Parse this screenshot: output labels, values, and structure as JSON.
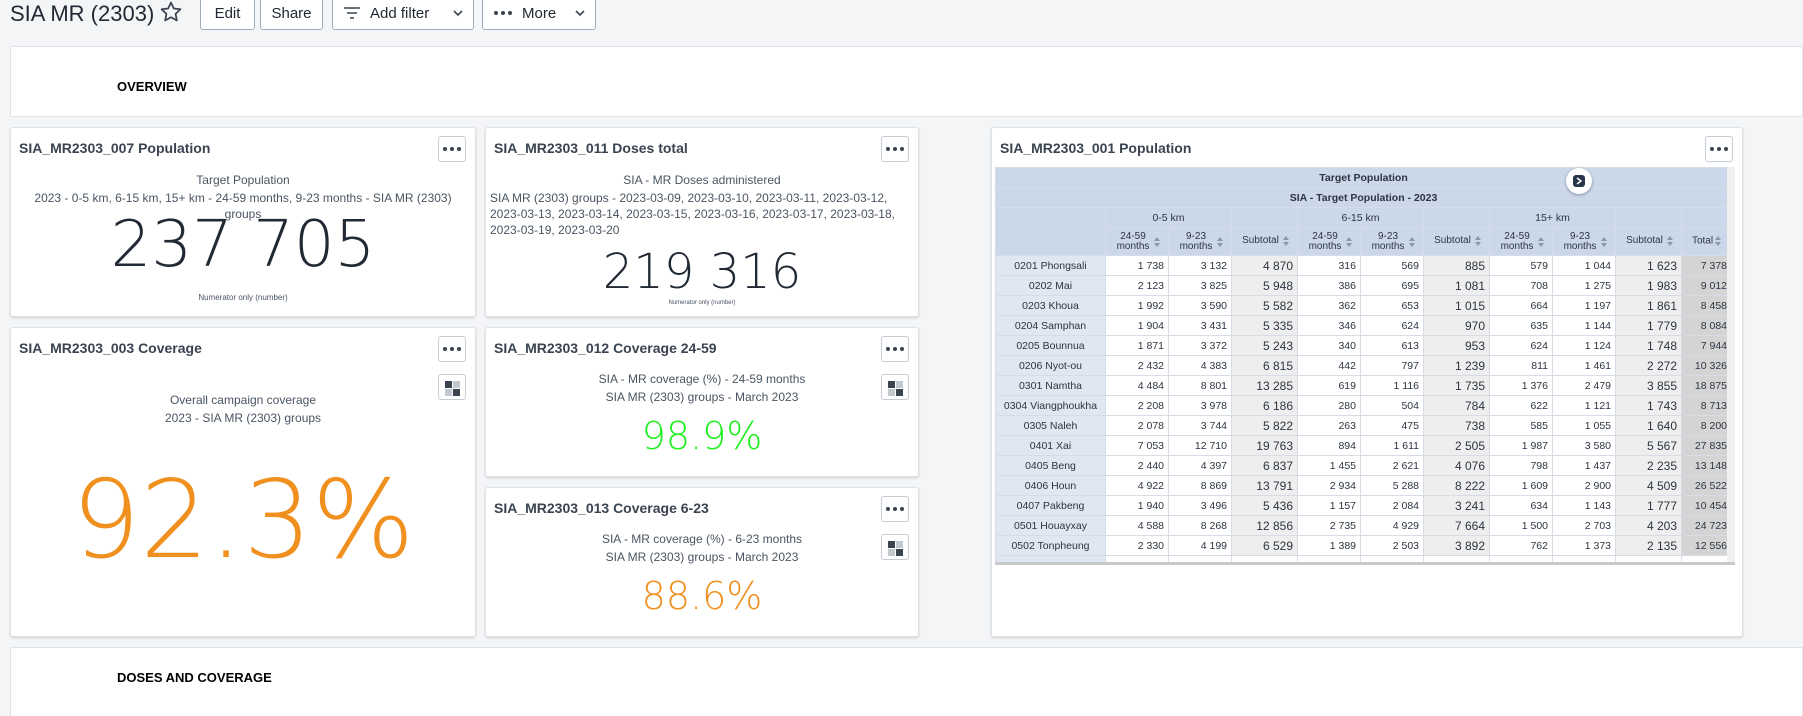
{
  "header": {
    "title": "SIA MR (2303)",
    "edit_label": "Edit",
    "share_label": "Share",
    "filter_label": "Add filter",
    "more_label": "More"
  },
  "sections": {
    "overview": "OVERVIEW",
    "doses": "DOSES AND COVERAGE"
  },
  "cards": {
    "population": {
      "title": "SIA_MR2303_007 Population",
      "subtitle1": "Target Population",
      "subtitle2": "2023 - 0-5 km, 6-15 km, 15+ km - 24-59 months, 9-23 months - SIA MR (2303) groups",
      "value": "237 705",
      "note": "Numerator only (number)"
    },
    "doses": {
      "title": "SIA_MR2303_011 Doses total",
      "subtitle1": "SIA - MR Doses administered",
      "subtitle2": "SIA MR (2303) groups - 2023-03-09, 2023-03-10, 2023-03-11, 2023-03-12, 2023-03-13, 2023-03-14, 2023-03-15, 2023-03-16, 2023-03-17, 2023-03-18, 2023-03-19, 2023-03-20",
      "value": "219 316",
      "note": "Numerator only (number)"
    },
    "coverage": {
      "title": "SIA_MR2303_003 Coverage",
      "subtitle1": "Overall campaign coverage",
      "subtitle2": "2023 - SIA MR (2303) groups",
      "value": "92.3%",
      "color": "#f0901f"
    },
    "cov2459": {
      "title": "SIA_MR2303_012 Coverage 24-59",
      "subtitle1": "SIA - MR coverage (%) - 24-59 months",
      "subtitle2": "SIA MR (2303) groups - March 2023",
      "value": "98.9%",
      "color": "#21f021"
    },
    "cov623": {
      "title": "SIA_MR2303_013 Coverage 6-23",
      "subtitle1": "SIA - MR coverage (%) - 6-23 months",
      "subtitle2": "SIA MR (2303) groups - March 2023",
      "value": "88.6%",
      "color": "#f0901f"
    },
    "pivot": {
      "title": "SIA_MR2303_001 Population",
      "header1": "Target Population",
      "header2": "SIA - Target Population - 2023",
      "groups": [
        "0-5 km",
        "6-15 km",
        "15+ km"
      ],
      "sub_cols": [
        "24-59 months",
        "9-23 months",
        "Subtotal"
      ],
      "total_label": "Total",
      "rows": [
        {
          "ou": "0201 Phongsali",
          "v": [
            "1 738",
            "3 132",
            "4 870",
            "316",
            "569",
            "885",
            "579",
            "1 044",
            "1 623",
            "7 378"
          ]
        },
        {
          "ou": "0202 Mai",
          "v": [
            "2 123",
            "3 825",
            "5 948",
            "386",
            "695",
            "1 081",
            "708",
            "1 275",
            "1 983",
            "9 012"
          ]
        },
        {
          "ou": "0203 Khoua",
          "v": [
            "1 992",
            "3 590",
            "5 582",
            "362",
            "653",
            "1 015",
            "664",
            "1 197",
            "1 861",
            "8 458"
          ]
        },
        {
          "ou": "0204 Samphan",
          "v": [
            "1 904",
            "3 431",
            "5 335",
            "346",
            "624",
            "970",
            "635",
            "1 144",
            "1 779",
            "8 084"
          ]
        },
        {
          "ou": "0205 Bounnua",
          "v": [
            "1 871",
            "3 372",
            "5 243",
            "340",
            "613",
            "953",
            "624",
            "1 124",
            "1 748",
            "7 944"
          ]
        },
        {
          "ou": "0206 Nyot-ou",
          "v": [
            "2 432",
            "4 383",
            "6 815",
            "442",
            "797",
            "1 239",
            "811",
            "1 461",
            "2 272",
            "10 326"
          ]
        },
        {
          "ou": "0301 Namtha",
          "v": [
            "4 484",
            "8 801",
            "13 285",
            "619",
            "1 116",
            "1 735",
            "1 376",
            "2 479",
            "3 855",
            "18 875"
          ]
        },
        {
          "ou": "0304 Viangphoukha",
          "v": [
            "2 208",
            "3 978",
            "6 186",
            "280",
            "504",
            "784",
            "622",
            "1 121",
            "1 743",
            "8 713"
          ]
        },
        {
          "ou": "0305 Naleh",
          "v": [
            "2 078",
            "3 744",
            "5 822",
            "263",
            "475",
            "738",
            "585",
            "1 055",
            "1 640",
            "8 200"
          ]
        },
        {
          "ou": "0401 Xai",
          "v": [
            "7 053",
            "12 710",
            "19 763",
            "894",
            "1 611",
            "2 505",
            "1 987",
            "3 580",
            "5 567",
            "27 835"
          ]
        },
        {
          "ou": "0405 Beng",
          "v": [
            "2 440",
            "4 397",
            "6 837",
            "1 455",
            "2 621",
            "4 076",
            "798",
            "1 437",
            "2 235",
            "13 148"
          ]
        },
        {
          "ou": "0406 Houn",
          "v": [
            "4 922",
            "8 869",
            "13 791",
            "2 934",
            "5 288",
            "8 222",
            "1 609",
            "2 900",
            "4 509",
            "26 522"
          ]
        },
        {
          "ou": "0407 Pakbeng",
          "v": [
            "1 940",
            "3 496",
            "5 436",
            "1 157",
            "2 084",
            "3 241",
            "634",
            "1 143",
            "1 777",
            "10 454"
          ]
        },
        {
          "ou": "0501 Houayxay",
          "v": [
            "4 588",
            "8 268",
            "12 856",
            "2 735",
            "4 929",
            "7 664",
            "1 500",
            "2 703",
            "4 203",
            "24 723"
          ]
        },
        {
          "ou": "0502 Tonpheung",
          "v": [
            "2 330",
            "4 199",
            "6 529",
            "1 389",
            "2 503",
            "3 892",
            "762",
            "1 373",
            "2 135",
            "12 556"
          ]
        }
      ]
    }
  }
}
